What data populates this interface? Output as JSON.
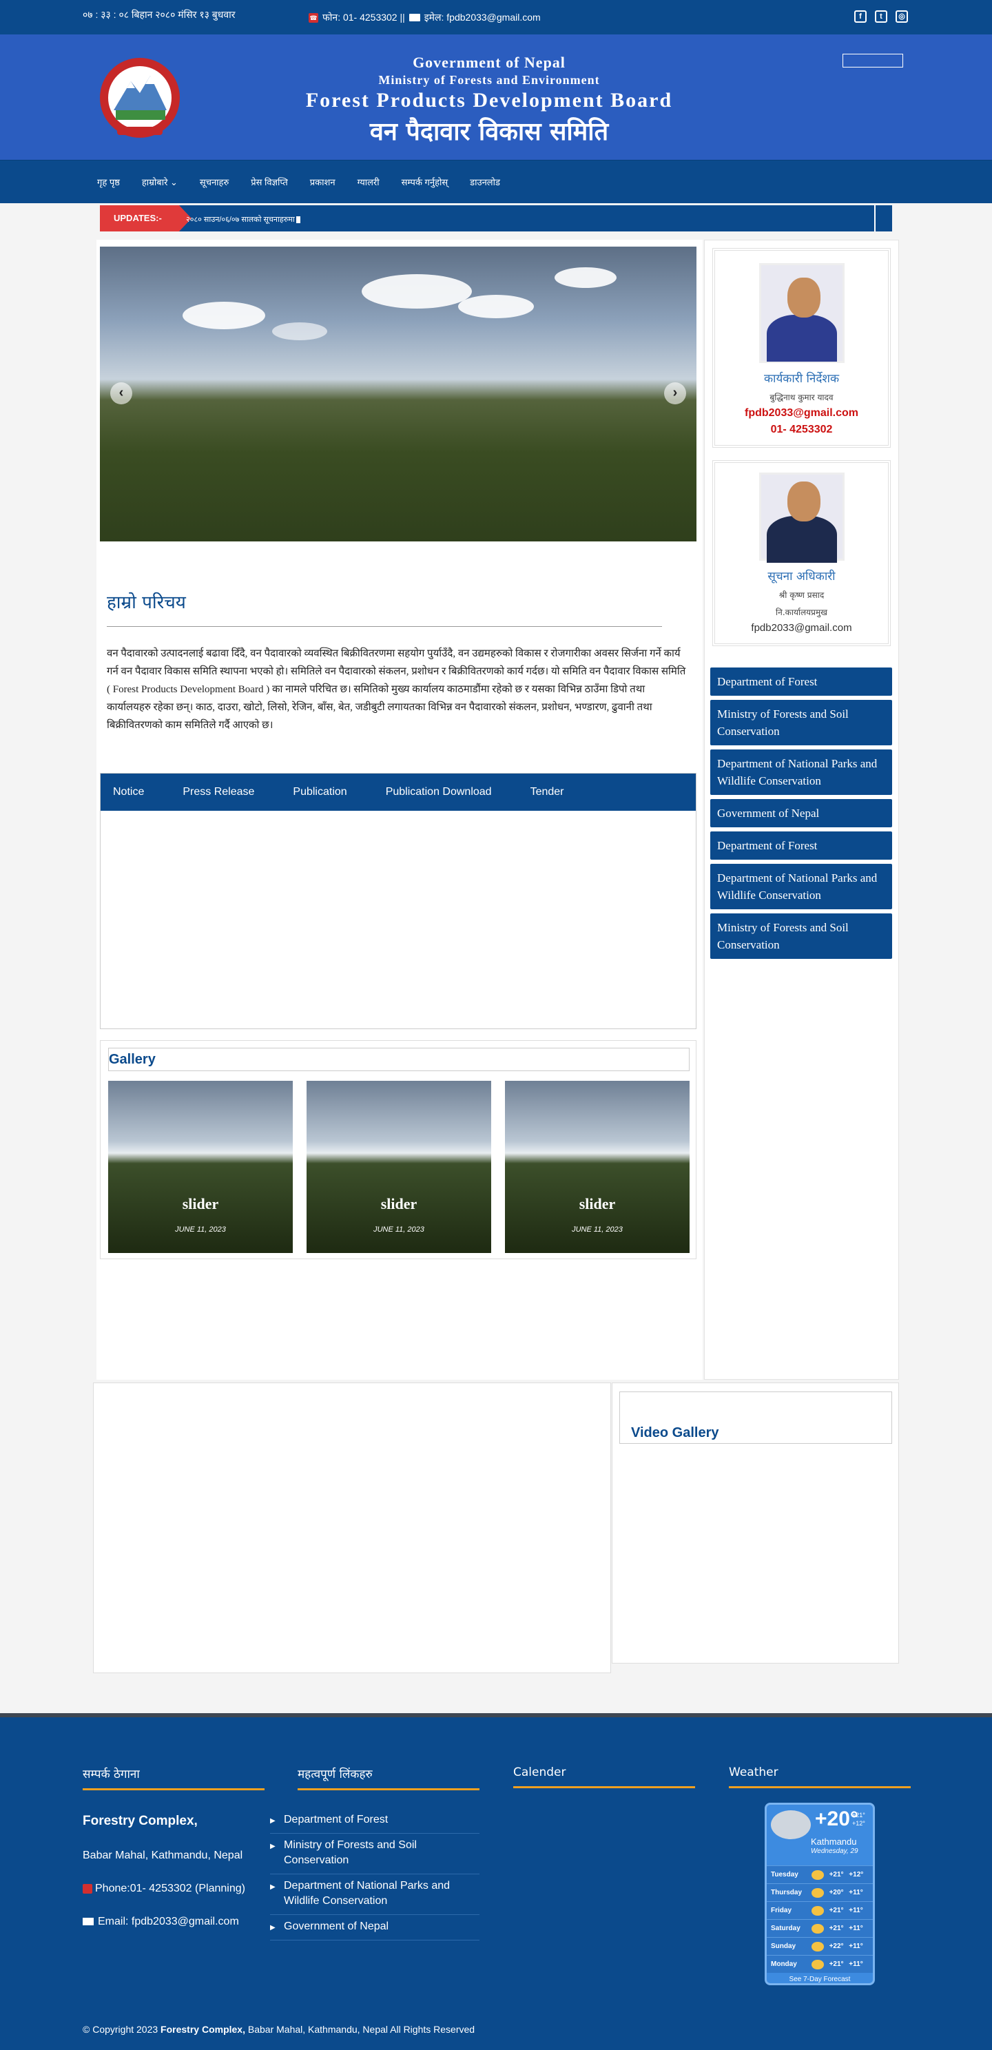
{
  "topbar": {
    "date": "०७ : ३३ : ०८ बिहान   २०८० मंसिर १३ बुधवार",
    "contact": "फोन: 01- 4253302 ||",
    "email": "इमेल: fpdb2033@gmail.com",
    "social": [
      "facebook-icon",
      "twitter-icon",
      "instagram-icon"
    ]
  },
  "header": {
    "gov": "Government of Nepal",
    "ministry": "Ministry of Forests and Environment",
    "board": "Forest Products Development Board",
    "board_np": "वन पैदावार विकास समिति"
  },
  "nav": {
    "items": [
      "गृह पृष्ठ",
      "हाम्रोबारे",
      "सूचनाहरु",
      "प्रेस विज्ञप्ति",
      "प्रकाशन",
      "ग्यालरी",
      "सम्पर्क गर्नुहोस्",
      "डाउनलोड"
    ]
  },
  "ticker": {
    "label": "UPDATES:-",
    "text": "२०८० साउन/०६/०७ सालको सूचनाहरुमा"
  },
  "about": {
    "title": "हाम्रो परिचय",
    "body": "वन पैदावारको उत्पादनलाई बढावा दिँदै, वन पैदावारको व्यवस्थित बिक्रीवितरणमा सहयोग पुर्याउँदै, वन उद्यमहरुको विकास र रोजगारीका अवसर सिर्जना गर्ने कार्य गर्न वन पैदावार विकास समिति स्थापना भएको हो। समितिले वन पैदावारको संकलन, प्रशोधन र बिक्रीवितरणको कार्य गर्दछ। यो समिति वन पैदावार विकास समिति ( Forest Products Development Board ) का नामले परिचित छ। समितिको मुख्य कार्यालय काठमाडौंमा रहेको छ र यसका विभिन्न ठाउँमा डिपो तथा कार्यालयहरु रहेका छन्। काठ, दाउरा, खोटो, लिसो, रेजिन, बाँस, बेत, जडीबुटी लगायतका विभिन्न वन पैदावारको संकलन, प्रशोधन, भण्डारण, ढुवानी तथा बिक्रीवितरणको काम समितिले गर्दै आएको छ।"
  },
  "tabs": [
    "Notice",
    "Press Release",
    "Publication",
    "Publication Download",
    "Tender"
  ],
  "gallery": {
    "title": "Gallery",
    "items": [
      {
        "caption": "slider",
        "date": "JUNE 11, 2023"
      },
      {
        "caption": "slider",
        "date": "JUNE 11, 2023"
      },
      {
        "caption": "slider",
        "date": "JUNE 11, 2023"
      }
    ]
  },
  "people": [
    {
      "name": "कार्यकारी निर्देशक",
      "role": "बुद्धिनाथ कुमार यादव",
      "email": "fpdb2033@gmail.com",
      "phone": "01- 4253302"
    },
    {
      "name": "सूचना अधिकारी",
      "role": "श्री कृष्ण प्रसाद",
      "sub": "नि.कार्यालयप्रमुख",
      "email": "fpdb2033@gmail.com"
    }
  ],
  "sidebar_links": [
    "Department of Forest",
    "Ministry of Forests and Soil Conservation",
    "Department of National Parks and Wildlife Conservation",
    "Government of Nepal",
    "Department of Forest",
    "Department of National Parks and Wildlife Conservation",
    "Ministry of Forests and Soil Conservation"
  ],
  "video_gallery": "Video Gallery",
  "footer": {
    "col1_title": "सम्पर्क ठेगाना",
    "org": "Forestry Complex,",
    "address": "Babar Mahal, Kathmandu, Nepal",
    "phone": "Phone:01- 4253302 (Planning)",
    "email": "Email: fpdb2033@gmail.com",
    "col2_title": "महत्वपूर्ण लिंकहरु",
    "links": [
      "Department of Forest",
      "Ministry of Forests and Soil Conservation",
      "Department of National Parks and Wildlife Conservation",
      "Government of Nepal"
    ],
    "col3_title": "Calender",
    "col4_title": "Weather",
    "copyright_pre": "© Copyright 2023",
    "copyright_org": "Forestry Complex,",
    "copyright_post": "Babar Mahal, Kathmandu, Nepal All Rights Reserved"
  },
  "weather": {
    "temp": "+20°",
    "unit": "C",
    "hi": "+21°",
    "lo": "+12°",
    "city": "Kathmandu",
    "day": "Wednesday, 29",
    "forecast": [
      {
        "day": "Tuesday",
        "hi": "+21°",
        "lo": "+12°"
      },
      {
        "day": "Thursday",
        "hi": "+20°",
        "lo": "+11°"
      },
      {
        "day": "Friday",
        "hi": "+21°",
        "lo": "+11°"
      },
      {
        "day": "Saturday",
        "hi": "+21°",
        "lo": "+11°"
      },
      {
        "day": "Sunday",
        "hi": "+22°",
        "lo": "+11°"
      },
      {
        "day": "Monday",
        "hi": "+21°",
        "lo": "+11°"
      }
    ],
    "link": "See 7-Day Forecast"
  },
  "colors": {
    "brand_blue": "#0b4a8c",
    "header_blue": "#2b5dbf",
    "accent_red": "#e03a3a",
    "accent_orange": "#f0a020"
  }
}
